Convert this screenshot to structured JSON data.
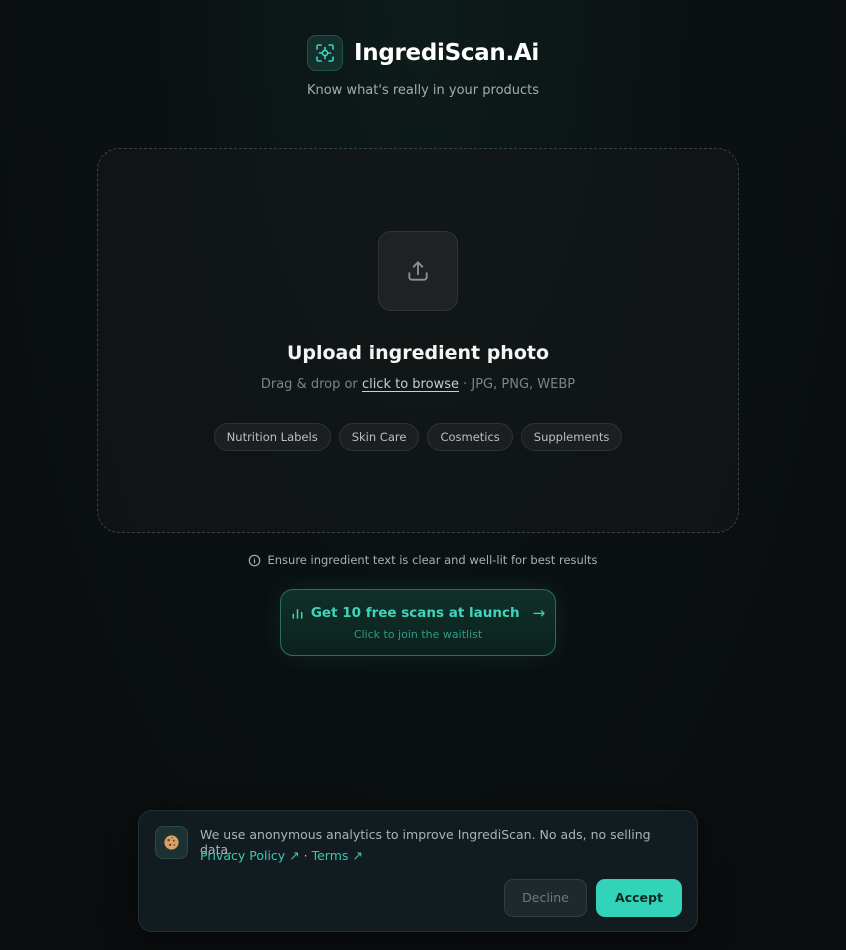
{
  "header": {
    "brand_name": "IngrediScan.Ai",
    "tagline": "Know what's really in your products",
    "logo_icon": "scan-icon"
  },
  "upload": {
    "icon": "upload-icon",
    "title": "Upload ingredient photo",
    "sub_prefix": "Drag & drop or",
    "browse_link": "click to browse",
    "sub_suffix": "· JPG, PNG, WEBP",
    "chips": [
      "Nutrition Labels",
      "Skin Care",
      "Cosmetics",
      "Supplements"
    ]
  },
  "tip": {
    "icon": "info-circle-icon",
    "text": "Ensure ingredient text is clear and well-lit for best results"
  },
  "cta": {
    "icon": "bar-chart-icon",
    "title": "Get 10 free scans at launch",
    "arrow": "→",
    "subtitle": "Click to join the waitlist"
  },
  "cookie": {
    "icon": "cookie-icon",
    "message": "We use anonymous analytics to improve IngrediScan. No ads, no selling data.",
    "privacy_label": "Privacy Policy ↗",
    "separator": "·",
    "terms_label": "Terms ↗",
    "decline_label": "Decline",
    "accept_label": "Accept"
  },
  "colors": {
    "accent": "#32d3b8",
    "background": "#0a0c0d",
    "banner": "#121b1f"
  }
}
